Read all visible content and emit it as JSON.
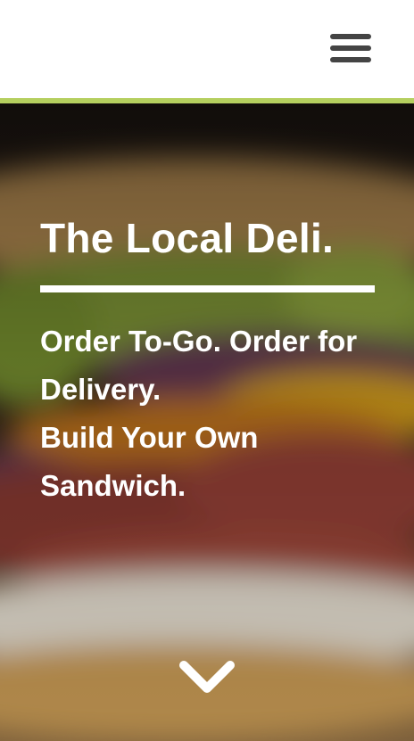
{
  "header": {
    "menu_icon": "hamburger-menu-icon"
  },
  "colors": {
    "accent": "#b5cf5f",
    "menu_icon": "#444444",
    "hero_text": "#ffffff"
  },
  "hero": {
    "background_image": "blurred close-up of a sandwich (hero photo)",
    "title": "The Local Deli.",
    "tagline_lines": [
      "Order To-Go. Order for Delivery.",
      "Build Your Own Sandwich."
    ],
    "scroll_icon": "chevron-down-icon"
  }
}
